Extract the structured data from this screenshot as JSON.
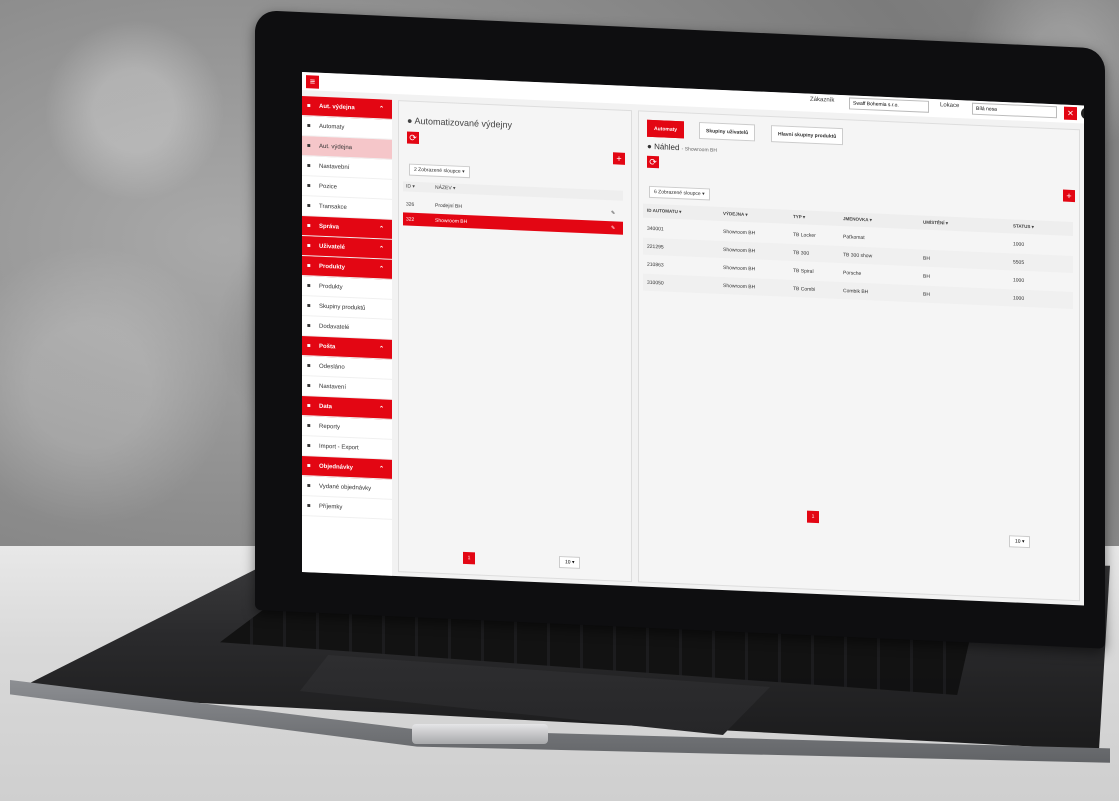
{
  "header": {
    "customer_label": "Zákazník",
    "customer_value": "Swaff Bohemia s.r.o.",
    "location_label": "Lokace",
    "location_value": "Bílá nosa",
    "close_glyph": "✕",
    "user_glyph": "●"
  },
  "sidebar": {
    "items": [
      {
        "label": "Aut. výdejna",
        "type": "head",
        "icon": "home-icon"
      },
      {
        "label": "Automaty",
        "type": "item",
        "icon": "grid-icon"
      },
      {
        "label": "Aut. výdejna",
        "type": "active",
        "icon": "machine-icon"
      },
      {
        "label": "Nastavební",
        "type": "item",
        "icon": "square-icon"
      },
      {
        "label": "Pozice",
        "type": "item",
        "icon": "grid-icon"
      },
      {
        "label": "Transakce",
        "type": "item",
        "icon": "swap-icon"
      },
      {
        "label": "Správa",
        "type": "head",
        "icon": "users-icon"
      },
      {
        "label": "Uživatelé",
        "type": "head",
        "icon": "users-icon"
      },
      {
        "label": "Produkty",
        "type": "head",
        "icon": "box-icon"
      },
      {
        "label": "Produkty",
        "type": "item",
        "icon": "hammer-icon"
      },
      {
        "label": "Skupiny produktů",
        "type": "item",
        "icon": "list-icon"
      },
      {
        "label": "Dodavatelé",
        "type": "item",
        "icon": "truck-icon"
      },
      {
        "label": "Pošta",
        "type": "head",
        "icon": "mail-icon"
      },
      {
        "label": "Odesláno",
        "type": "item",
        "icon": "send-icon"
      },
      {
        "label": "Nastavení",
        "type": "item",
        "icon": "gear-icon"
      },
      {
        "label": "Data",
        "type": "head",
        "icon": "cloud-icon"
      },
      {
        "label": "Reporty",
        "type": "item",
        "icon": "report-icon"
      },
      {
        "label": "Import - Export",
        "type": "item",
        "icon": "cloud-icon"
      },
      {
        "label": "Objednávky",
        "type": "head",
        "icon": "cart-icon"
      },
      {
        "label": "Vydané objednávky",
        "type": "item",
        "icon": "list-icon"
      },
      {
        "label": "Příjemky",
        "type": "item",
        "icon": "list-icon"
      }
    ]
  },
  "left_panel": {
    "title": "Automatizované výdejny",
    "refresh_glyph": "⟳",
    "add_glyph": "+",
    "columns_button": "2 Zobrazené sloupce",
    "col_id": "ID ▾",
    "col_name": "NÁZEV ▾",
    "rows": [
      {
        "id": "326",
        "name": "Prodejní BH",
        "selected": false
      },
      {
        "id": "322",
        "name": "Showroom BH",
        "selected": true
      }
    ],
    "page": "1",
    "per_page": "10"
  },
  "right_panel": {
    "tabs": [
      {
        "label": "Automaty",
        "active": true
      },
      {
        "label": "Skupiny uživatelů",
        "active": false
      },
      {
        "label": "Hlavní skupiny produktů",
        "active": false
      }
    ],
    "preview_title": "Náhled",
    "preview_subtitle": "- Showroom BH",
    "refresh_glyph": "⟳",
    "add_glyph": "+",
    "columns_button": "6 Zobrazené sloupce",
    "columns": [
      "ID AUTOMATU ▾",
      "VÝDEJNA ▾",
      "TYP ▾",
      "JMENOVKA ▾",
      "UMÍSTĚNÍ ▾",
      "STATUS ▾"
    ],
    "rows": [
      {
        "id": "340001",
        "vydejna": "Showroom BH",
        "typ": "TB Locker",
        "jmenovka": "Paťkomat",
        "umisteni": "",
        "status": "1000"
      },
      {
        "id": "221295",
        "vydejna": "Showroom BH",
        "typ": "TB 300",
        "jmenovka": "TB 300 show",
        "umisteni": "BH",
        "status": "5505"
      },
      {
        "id": "210863",
        "vydejna": "Showroom BH",
        "typ": "TB Spiral",
        "jmenovka": "Porsche",
        "umisteni": "BH",
        "status": "1000"
      },
      {
        "id": "310050",
        "vydejna": "Showroom BH",
        "typ": "TB Combi",
        "jmenovka": "Combik BH",
        "umisteni": "BH",
        "status": "1000"
      }
    ],
    "page": "1",
    "per_page": "10"
  },
  "colors": {
    "accent": "#e30613"
  }
}
